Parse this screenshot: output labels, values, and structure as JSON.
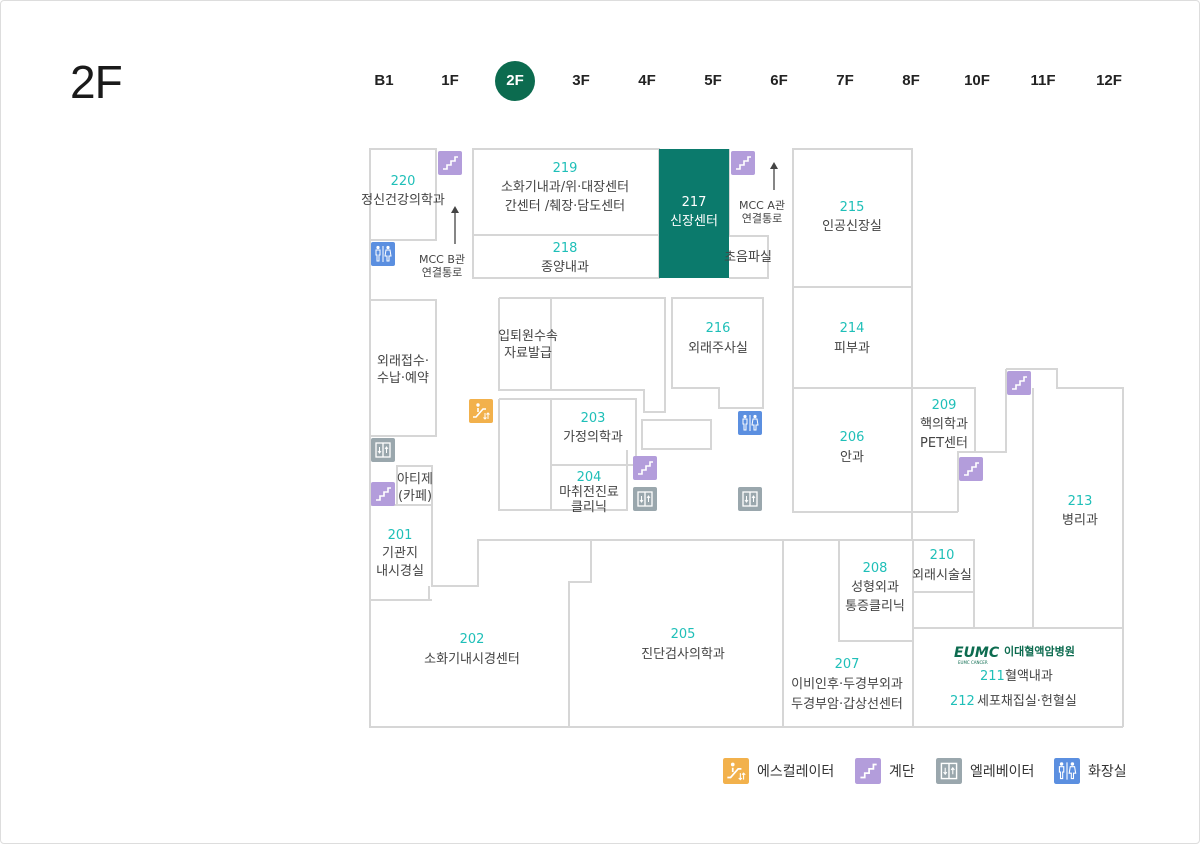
{
  "floor_title": "2F",
  "floor_tabs": [
    {
      "label": "B1",
      "active": false
    },
    {
      "label": "1F",
      "active": false
    },
    {
      "label": "2F",
      "active": true
    },
    {
      "label": "3F",
      "active": false
    },
    {
      "label": "4F",
      "active": false
    },
    {
      "label": "5F",
      "active": false
    },
    {
      "label": "6F",
      "active": false
    },
    {
      "label": "7F",
      "active": false
    },
    {
      "label": "8F",
      "active": false
    },
    {
      "label": "10F",
      "active": false
    },
    {
      "label": "11F",
      "active": false
    },
    {
      "label": "12F",
      "active": false
    }
  ],
  "colors": {
    "accent": "#0c6b4f",
    "highlight_room": "#0b7a6c",
    "room_number": "#1fbfb8",
    "wall": "#d6d6d6",
    "room_text": "#444444",
    "stairs": "#b39ddb",
    "elevator": "#9aa7ad",
    "escalator": "#f2b14c",
    "restroom": "#5b8fe0",
    "logo": "#0c6b4f"
  },
  "rooms": {
    "r220": {
      "num": "220",
      "name": "정신건강의학과"
    },
    "r219": {
      "num": "219",
      "line1": "소화기내과/위·대장센터",
      "line2": "간센터 /췌장·담도센터"
    },
    "r217": {
      "num": "217",
      "name": "신장센터"
    },
    "r215": {
      "num": "215",
      "name": "인공신장실"
    },
    "r218": {
      "num": "218",
      "name": "종양내과"
    },
    "ultrasound": {
      "name": "초음파실"
    },
    "mcc_b": {
      "line1": "MCC B관",
      "line2": "연결통로"
    },
    "mcc_a": {
      "line1": "MCC A관",
      "line2": "연결통로"
    },
    "reception": {
      "line1": "외래접수·",
      "line2": "수납·예약"
    },
    "admission": {
      "line1": "입퇴원수속",
      "line2": "자료발급"
    },
    "r216": {
      "num": "216",
      "name": "외래주사실"
    },
    "r214": {
      "num": "214",
      "name": "피부과"
    },
    "r203": {
      "num": "203",
      "name": "가정의학과"
    },
    "r204": {
      "num": "204",
      "line1": "마취전진료",
      "line2": "클리닉"
    },
    "r206": {
      "num": "206",
      "name": "안과"
    },
    "r209": {
      "num": "209",
      "line1": "핵의학과",
      "line2": "PET센터"
    },
    "r213": {
      "num": "213",
      "name": "병리과"
    },
    "cafe": {
      "line1": "아티제",
      "line2": "(카페)"
    },
    "r201": {
      "num": "201",
      "line1": "기관지",
      "line2": "내시경실"
    },
    "r202": {
      "num": "202",
      "name": "소화기내시경센터"
    },
    "r205": {
      "num": "205",
      "name": "진단검사의학과"
    },
    "r208": {
      "num": "208",
      "line1": "성형외과",
      "line2": "통증클리닉"
    },
    "r210": {
      "num": "210",
      "name": "외래시술실"
    },
    "r207": {
      "num": "207",
      "line1": "이비인후·두경부외과",
      "line2": "두경부암·갑상선센터"
    },
    "r211": {
      "num": "211",
      "name": "혈액내과"
    },
    "r212": {
      "num": "212",
      "name": "세포채집실·헌혈실"
    }
  },
  "logo": {
    "mark": "EUMC",
    "text": "이대혈액암병원",
    "sub": "EUMC CANCER"
  },
  "legend": [
    {
      "icon": "escalator-icon",
      "label": "에스컬레이터"
    },
    {
      "icon": "stairs-icon",
      "label": "계단"
    },
    {
      "icon": "elevator-icon",
      "label": "엘레베이터"
    },
    {
      "icon": "restroom-icon",
      "label": "화장실"
    }
  ]
}
